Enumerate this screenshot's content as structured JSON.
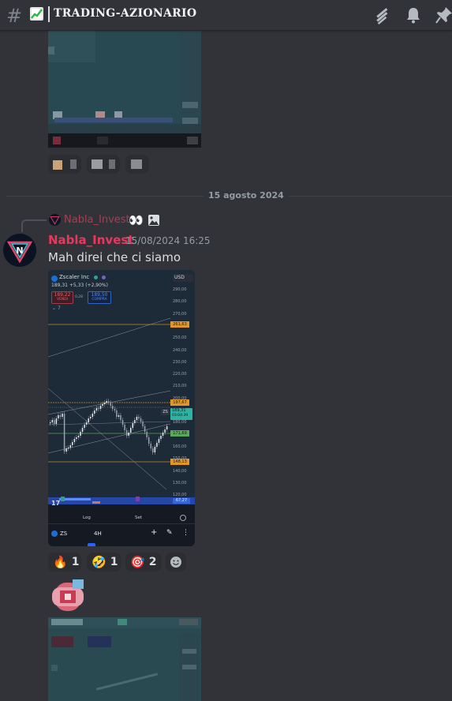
{
  "header": {
    "channel_name": "TRADING-AZIONARIO",
    "icons": [
      "hashtag-icon",
      "chart-increasing-emoji-icon",
      "threads-icon",
      "bell-icon",
      "pin-icon"
    ]
  },
  "previous_message": {
    "reactions": [
      "blurred",
      "blurred",
      "blurred"
    ]
  },
  "date_divider": "15 agosto 2024",
  "message": {
    "reply": {
      "username": "Nabla_Invest",
      "icons": [
        "eyes-emoji-icon",
        "image-icon"
      ]
    },
    "username": "Nabla_Invest",
    "timestamp": "15/08/2024 16:25",
    "text": "Mah direi che ci siamo",
    "attachment": {
      "ticker_name": "Zscaler Inc",
      "price_line": "189,31 +5,33 (+2,90%)",
      "sell_price": "189,22",
      "sell_label": "VENDI",
      "buy_price": "189,50",
      "buy_label": "COMPRA",
      "spread": "0,28",
      "currency": "USD",
      "indicator_count": "7",
      "price_axis": [
        "290,00",
        "280,00",
        "270,00",
        "260,00",
        "250,00",
        "240,00",
        "230,00",
        "220,00",
        "210,00",
        "200,00",
        "190,00",
        "180,00",
        "170,00",
        "160,00",
        "150,00",
        "140,00",
        "130,00",
        "120,00"
      ],
      "level_labels": {
        "upper": "261,63",
        "resistance": "197,67",
        "current": "189,31",
        "countdown": "03:04:39",
        "support": "171,69",
        "lower": "148,13"
      },
      "symbol_tag": "ZS",
      "oscillator_value": "67,27",
      "oscillator_left": "17",
      "log_label": "Log",
      "auto_label": "Set",
      "bottom_symbol": "ZS",
      "timeframe": "4H"
    },
    "reactions": [
      {
        "emoji": "🔥",
        "count": "1",
        "name": "fire-reaction"
      },
      {
        "emoji": "🤣",
        "count": "1",
        "name": "rofl-reaction"
      },
      {
        "emoji": "🎯",
        "count": "2",
        "name": "target-reaction"
      }
    ]
  },
  "colors": {
    "username": "#e8385c",
    "background": "#313338",
    "chart_bg": "#1e2a38"
  }
}
